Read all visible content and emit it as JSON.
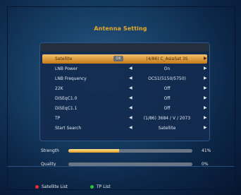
{
  "title": "Antenna Setting",
  "ok_label": "OK",
  "rows": [
    {
      "label": "Satellite",
      "value": "(4/86) C_AsiaSat 3S"
    },
    {
      "label": "LNB Power",
      "value": "On"
    },
    {
      "label": "LNB Frequency",
      "value": "OCS1(5150/5750)"
    },
    {
      "label": "22K",
      "value": "Off"
    },
    {
      "label": "DiSEqC1.0",
      "value": "Off"
    },
    {
      "label": "DiSEqC1.1",
      "value": "Off"
    },
    {
      "label": "TP",
      "value": "(1/86) 3684 / V / 2073"
    },
    {
      "label": "Start Search",
      "value": "Satellite"
    }
  ],
  "signal": {
    "strength_label": "Strength",
    "strength_pct": "41%",
    "strength_value": 0.41,
    "quality_label": "Quality",
    "quality_pct": "0%",
    "quality_value": 0.0
  },
  "footer": {
    "red_label": "Satellite List",
    "green_label": "TP List"
  },
  "arrows": {
    "left": "◀",
    "right": "▶"
  },
  "colors": {
    "accent": "#e8a82a",
    "red_key": "#e23030",
    "green_key": "#29c23b"
  }
}
